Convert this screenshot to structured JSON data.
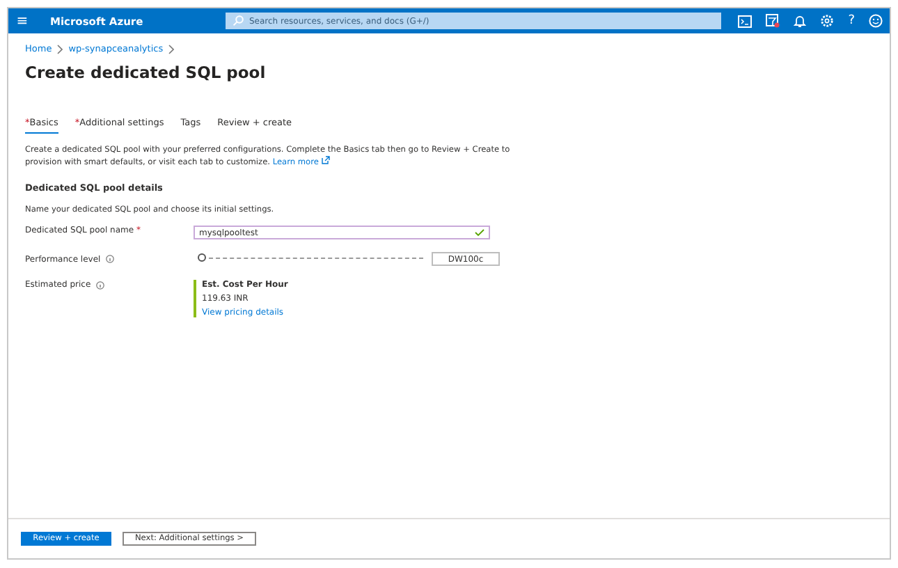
{
  "top_bar": {
    "menu_icon": "≡",
    "brand": "Microsoft Azure",
    "search": {
      "placeholder": "Search resources, services, and docs (G+/)"
    },
    "help": "?"
  },
  "breadcrumb": [
    "Home",
    "wp-synapceanalytics"
  ],
  "title": "Create dedicated SQL pool",
  "tabs": [
    {
      "required_mark": "*",
      "label": "Basics",
      "selected": true
    },
    {
      "required_mark": "*",
      "label": "Additional settings",
      "selected": false
    },
    {
      "label": "Tags",
      "selected": false
    },
    {
      "label": "Review + create",
      "selected": false
    }
  ],
  "description": "Create a dedicated SQL pool with your preferred configurations. Complete the Basics tab then go to Review + Create to provision with smart defaults, or visit each tab to customize.",
  "learn_more": "Learn more",
  "section": {
    "heading": "Dedicated SQL pool details",
    "subtext": "Name your dedicated SQL pool and choose its initial settings."
  },
  "fields": [
    {
      "kind": "text",
      "label": "Dedicated SQL pool name",
      "required_mark": "*",
      "value": "mysqlpooltest",
      "valid": true
    },
    {
      "kind": "slider",
      "label": "Performance level",
      "info": true,
      "level": 0,
      "value": "DW100c"
    },
    {
      "kind": "price",
      "label": "Estimated price",
      "info": true,
      "heading": "Est. Cost Per Hour",
      "amount": "119.63 INR",
      "link": "View pricing details"
    }
  ],
  "buttons": [
    {
      "label": "Review + create",
      "primary": true
    },
    {
      "label": "Next: Additional settings >",
      "primary": false
    }
  ]
}
